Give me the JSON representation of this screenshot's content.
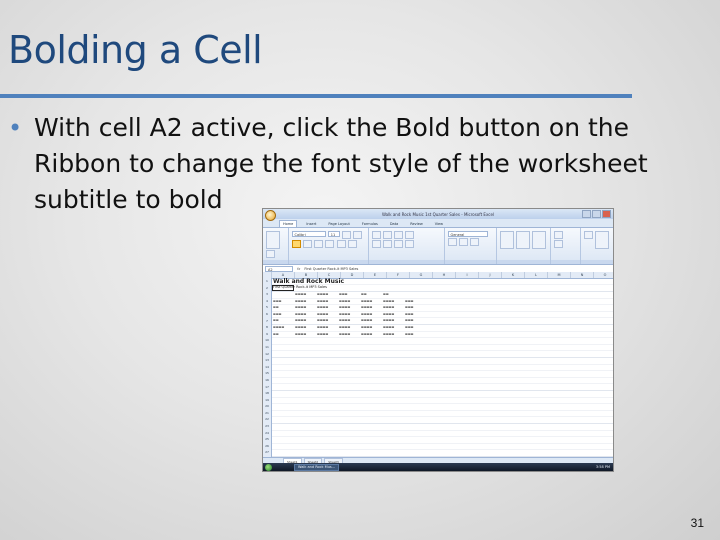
{
  "slide": {
    "title": "Bolding a Cell",
    "bullet": "With cell A2 active, click the Bold button on the Ribbon to change the font style of the worksheet subtitle to bold",
    "number": "31",
    "accent": "#4f81bd",
    "title_color": "#1f497d"
  },
  "screenshot": {
    "window_title": "Walk and Rock Music 1st Quarter Sales - Microsoft Excel",
    "tabs": [
      "Home",
      "Insert",
      "Page Layout",
      "Formulas",
      "Data",
      "Review",
      "View"
    ],
    "active_tab": "Home",
    "font_name": "Calibri",
    "font_size": "11",
    "number_format": "General",
    "name_box": "A2",
    "formula": "First Quarter Rock-it MP3 Sales",
    "sheet_title": "Walk and Rock Music",
    "sheet_subtitle": "First Quarter Rock-it MP3 Sales",
    "columns": [
      "A",
      "B",
      "C",
      "D",
      "E",
      "F",
      "G",
      "H",
      "I",
      "J",
      "K",
      "L",
      "M",
      "N",
      "O"
    ],
    "sheet_tabs": [
      "Sheet1",
      "Sheet2",
      "Sheet3"
    ],
    "taskbar_item": "Walk and Rock Mus...",
    "clock": "3:58 PM"
  }
}
